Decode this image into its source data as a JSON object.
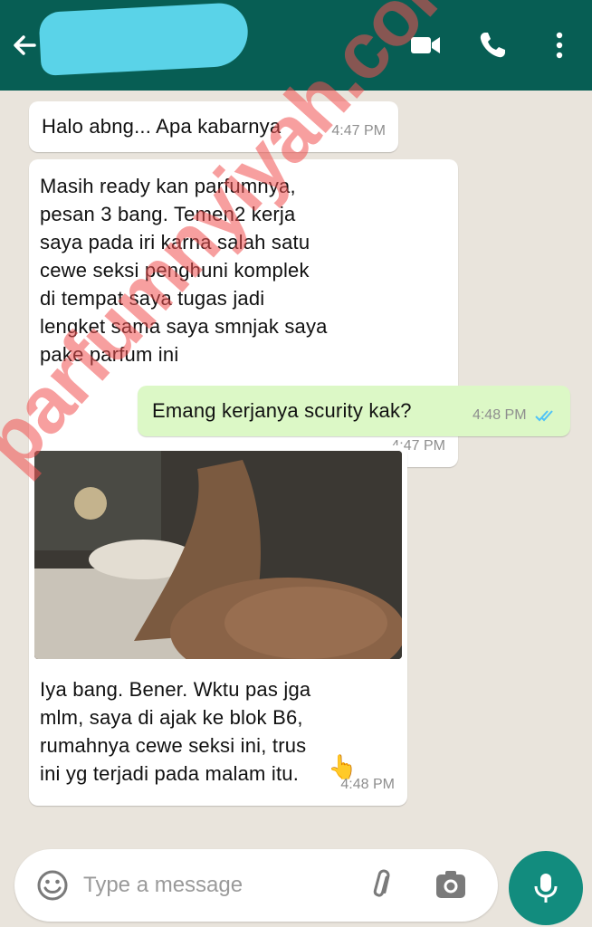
{
  "header": {
    "contact_name": "",
    "icons": [
      "back-arrow-icon",
      "video-call-icon",
      "phone-icon",
      "more-vert-icon"
    ]
  },
  "messages": [
    {
      "direction": "in",
      "text": "Halo abng... Apa kabarnya",
      "time": "4:47 PM"
    },
    {
      "direction": "in",
      "text": "Masih ready kan parfumnya,\npesan 3 bang. Temen2 kerja\nsaya pada iri karna salah satu\ncewe seksi penghuni komplek\ndi tempat saya tugas jadi\nlengket sama saya smnjak saya\npake parfum ini",
      "time": "4:47 PM"
    },
    {
      "direction": "out",
      "text": "Emang kerjanya scurity kak?",
      "time": "4:48 PM",
      "status": "read"
    },
    {
      "direction": "in",
      "has_image": true,
      "text": "Iya bang. Bener. Wktu pas jga\nmlm, saya di ajak ke blok B6,\nrumahnya cewe seksi ini, trus\nini yg terjadi pada malam itu.",
      "emoji": "👆",
      "time": "4:48 PM"
    }
  ],
  "watermark": "parfumnyiyah.com",
  "composer": {
    "placeholder": "Type a message",
    "icons": [
      "emoji-icon",
      "attach-icon",
      "camera-icon",
      "mic-icon"
    ]
  },
  "colors": {
    "header": "#075e54",
    "outgoing": "#dcf8c6",
    "incoming": "#ffffff",
    "mic": "#128c7e",
    "ticks": "#4fc3f7"
  }
}
